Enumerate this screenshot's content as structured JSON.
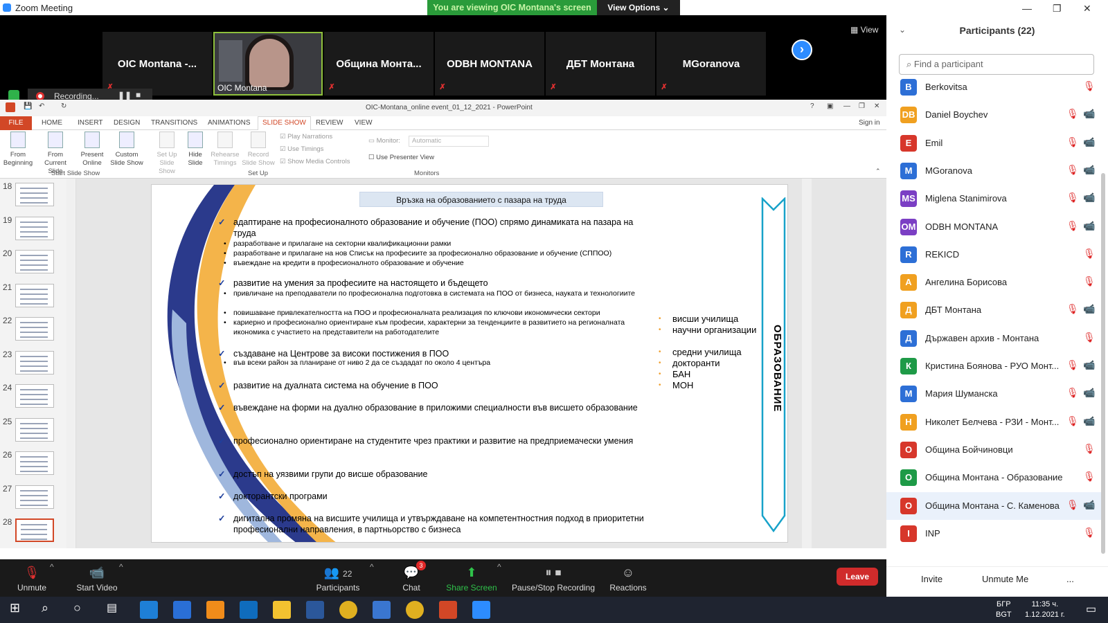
{
  "window": {
    "title": "Zoom Meeting"
  },
  "share_banner": {
    "text": "You are viewing OIC Montana's screen",
    "view_options": "View Options"
  },
  "video_strip": {
    "tiles": [
      {
        "name": "OIC Montana -..."
      },
      {
        "name": "OIC Montana",
        "video": true
      },
      {
        "name": "Община Монта..."
      },
      {
        "name": "ODBH MONTANA"
      },
      {
        "name": "ДБТ Монтана"
      },
      {
        "name": "MGoranova"
      }
    ],
    "view_label": "View"
  },
  "recording": {
    "label": "Recording..."
  },
  "ppt": {
    "title": "OIC-Montana_online event_01_12_2021 - PowerPoint",
    "sign_in": "Sign in",
    "tabs": [
      "FILE",
      "HOME",
      "INSERT",
      "DESIGN",
      "TRANSITIONS",
      "ANIMATIONS",
      "SLIDE SHOW",
      "REVIEW",
      "VIEW"
    ],
    "ribbon": {
      "from_beginning": "From Beginning",
      "from_current": "From Current Slide",
      "present_online": "Present Online",
      "custom_show": "Custom Slide Show",
      "setup_show": "Set Up Slide Show",
      "hide_slide": "Hide Slide",
      "rehearse": "Rehearse Timings",
      "record": "Record Slide Show",
      "play_narrations": "Play Narrations",
      "use_timings": "Use Timings",
      "show_media": "Show Media Controls",
      "monitor_label": "Monitor:",
      "monitor_value": "Automatic",
      "presenter_view": "Use Presenter View",
      "group_start": "Start Slide Show",
      "group_setup": "Set Up",
      "group_monitors": "Monitors"
    },
    "thumbnails": [
      "18",
      "19",
      "20",
      "21",
      "22",
      "23",
      "24",
      "25",
      "26",
      "27",
      "28"
    ]
  },
  "slide": {
    "header": "Връзка на образованието с пазара на труда",
    "vertical_label": "ОБРАЗОВАНИЕ",
    "items": [
      {
        "type": "main",
        "text": "адаптиране на професионалното образование и обучение (ПОО) спрямо динамиката на пазара на труда"
      },
      {
        "type": "sub",
        "text": "разработване и прилагане на секторни квалификационни рамки"
      },
      {
        "type": "sub",
        "text": "разработване и прилагане на нов Списък на професиите за професионално образование и обучение (СППОО)"
      },
      {
        "type": "sub",
        "text": "въвеждане на кредити в професионалното образование и обучение"
      },
      {
        "type": "main",
        "text": "развитие на умения за професиите на настоящето и бъдещето"
      },
      {
        "type": "sub",
        "text": "привличане на преподаватели по професионална подготовка в системата на ПОО от бизнеса, науката и технологиите"
      },
      {
        "type": "sub",
        "text": "повишаване привлекателността на ПОО и професионалната реализация по ключови икономически сектори"
      },
      {
        "type": "sub",
        "text": "кариерно и професионално ориентиране към професии, характерни за тенденциите в развитието на регионалната икономика с участието на представители на работодателите"
      },
      {
        "type": "main",
        "text": "създаване на Центрове за високи постижения в ПОО"
      },
      {
        "type": "sub",
        "text": "във всеки район за планиране от ниво 2 да се създадат по около 4 центъра"
      },
      {
        "type": "main",
        "text": "развитие на дуалната система на обучение в ПОО"
      },
      {
        "type": "main",
        "text": "въвеждане на форми на дуално образование в приложими специалности във висшето образование"
      },
      {
        "type": "main",
        "text": "професионално ориентиране на студентите чрез практики и развитие на предприемачески умения"
      },
      {
        "type": "main",
        "text": "достъп на уязвими групи до висше образование"
      },
      {
        "type": "main",
        "text": "докторантски програми"
      },
      {
        "type": "main",
        "text": "дигитална промяна на висшите училища и утвърждаване на компетентностния подход в приоритетни професионални направления, в партньорство с бизнеса"
      }
    ],
    "right_list": [
      "висши училища",
      "научни организации",
      "средни училища",
      "докторанти",
      "БАН",
      "МОН"
    ]
  },
  "toolbar": {
    "unmute": "Unmute",
    "start_video": "Start Video",
    "participants": "Participants",
    "participants_count": "22",
    "chat": "Chat",
    "chat_badge": "3",
    "share_screen": "Share Screen",
    "pause_recording": "Pause/Stop Recording",
    "reactions": "Reactions",
    "leave": "Leave"
  },
  "panel": {
    "title": "Participants (22)",
    "search_placeholder": "Find a participant",
    "participants": [
      {
        "initials": "B",
        "name": "Berkovitsa",
        "color": "#2d6fd6",
        "cam": "none"
      },
      {
        "initials": "DB",
        "name": "Daniel Boychev",
        "color": "#f0a020",
        "cam": "off"
      },
      {
        "initials": "E",
        "name": "Emil",
        "color": "#d7372b",
        "cam": "off"
      },
      {
        "initials": "M",
        "name": "MGoranova",
        "color": "#2d6fd6",
        "cam": "off"
      },
      {
        "initials": "MS",
        "name": "Miglena Stanimirova",
        "color": "#7b3fc4",
        "cam": "off"
      },
      {
        "initials": "OM",
        "name": "ODBH MONTANA",
        "color": "#7b3fc4",
        "cam": "off"
      },
      {
        "initials": "R",
        "name": "REKICD",
        "color": "#2d6fd6",
        "cam": "none"
      },
      {
        "initials": "А",
        "name": "Ангелина Борисова",
        "color": "#f0a020",
        "cam": "none"
      },
      {
        "initials": "Д",
        "name": "ДБТ Монтана",
        "color": "#f0a020",
        "cam": "off"
      },
      {
        "initials": "Д",
        "name": "Държавен архив - Монтана",
        "color": "#2d6fd6",
        "cam": "none"
      },
      {
        "initials": "К",
        "name": "Кристина Боянова - РУО Монт...",
        "color": "#1e9a47",
        "cam": "off"
      },
      {
        "initials": "М",
        "name": "Мария Шуманска",
        "color": "#2d6fd6",
        "cam": "off"
      },
      {
        "initials": "Н",
        "name": "Николет Белчева - РЗИ - Монт...",
        "color": "#f0a020",
        "cam": "on"
      },
      {
        "initials": "О",
        "name": "Община Бойчиновци",
        "color": "#d7372b",
        "cam": "none"
      },
      {
        "initials": "О",
        "name": "Община Монтана - Образование",
        "color": "#1e9a47",
        "cam": "none"
      },
      {
        "initials": "О",
        "name": "Община Монтана - С. Каменова",
        "color": "#d7372b",
        "cam": "off"
      },
      {
        "initials": "I",
        "name": "INP",
        "color": "#d7372b",
        "cam": "none"
      }
    ],
    "invite": "Invite",
    "unmute_me": "Unmute Me",
    "more": "..."
  },
  "taskbar": {
    "lang1": "БГР",
    "lang2": "BGT",
    "time": "11:35 ч.",
    "date": "1.12.2021 г."
  }
}
